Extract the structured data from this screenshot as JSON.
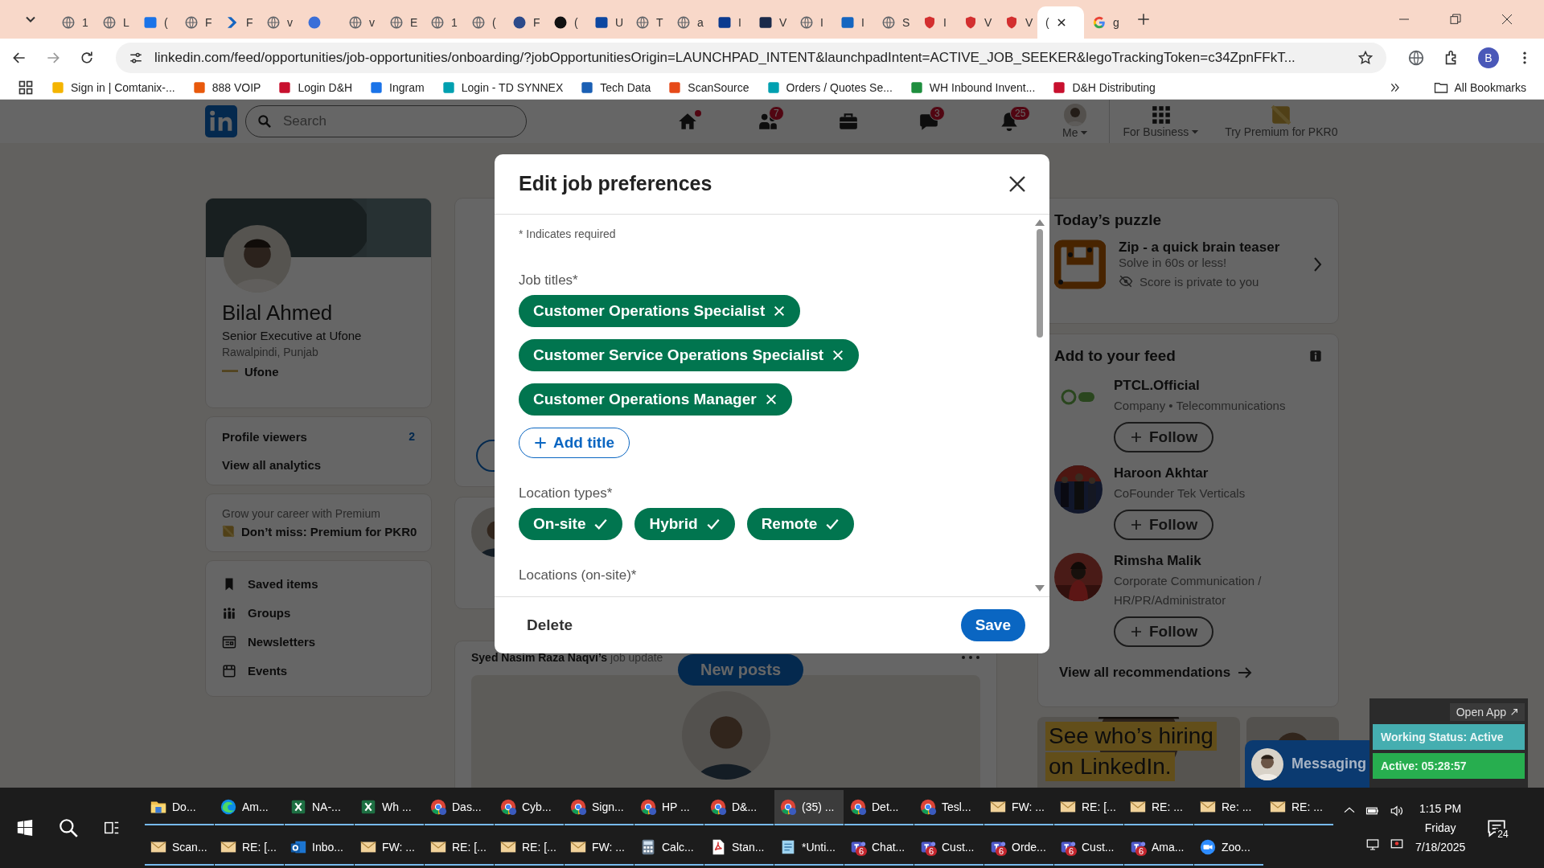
{
  "browser": {
    "tabs": [
      {
        "title": "1",
        "kind": "globe",
        "selected": false
      },
      {
        "title": "L",
        "kind": "globe",
        "selected": false
      },
      {
        "title": "(",
        "kind": "square",
        "color": "#1a73e8",
        "selected": false
      },
      {
        "title": "F",
        "kind": "globe",
        "selected": false
      },
      {
        "title": "F",
        "kind": "chevron",
        "color": "#1565c0",
        "selected": false
      },
      {
        "title": "v",
        "kind": "globe",
        "selected": false
      },
      {
        "kind": "circle",
        "color": "#3b6fd8",
        "selected": false
      },
      {
        "title": "v",
        "kind": "globe",
        "selected": false
      },
      {
        "title": "E",
        "kind": "globe",
        "selected": false
      },
      {
        "title": "1",
        "kind": "globe",
        "selected": false
      },
      {
        "title": "(",
        "kind": "globe",
        "selected": false
      },
      {
        "title": "F",
        "kind": "circle",
        "color": "#2c4a8a",
        "selected": false
      },
      {
        "title": "(",
        "kind": "circle",
        "color": "#111111",
        "selected": false
      },
      {
        "title": "U",
        "kind": "square",
        "color": "#0d47a1",
        "selected": false
      },
      {
        "title": "T",
        "kind": "globe",
        "selected": false
      },
      {
        "title": "a",
        "kind": "globe",
        "selected": false
      },
      {
        "title": "I",
        "kind": "square",
        "color": "#0b3a8f",
        "selected": false
      },
      {
        "title": "V",
        "kind": "square",
        "color": "#1b2a4a",
        "selected": false
      },
      {
        "title": "I",
        "kind": "globe",
        "selected": false
      },
      {
        "title": "I",
        "kind": "square",
        "color": "#1565c0",
        "selected": false
      },
      {
        "title": "S",
        "kind": "globe",
        "selected": false
      },
      {
        "title": "I",
        "kind": "shield",
        "color": "#d32f2f",
        "selected": false
      },
      {
        "title": "V",
        "kind": "shield",
        "color": "#d32f2f",
        "selected": false
      },
      {
        "title": "V",
        "kind": "shield",
        "color": "#d32f2f",
        "selected": false
      },
      {
        "title": "(",
        "selected": true
      },
      {
        "title": "g",
        "kind": "google",
        "selected": false
      }
    ],
    "url": "linkedin.com/feed/opportunities/job-opportunities/onboarding/?jobOpportunitiesOrigin=LAUNCHPAD_INTENT&launchpadIntent=ACTIVE_JOB_SEEKER&legoTrackingToken=c34ZpnFFkT...",
    "profile": "B",
    "bookmarks": [
      {
        "label": "Sign in | Comtanix-...",
        "color": "#f4b400"
      },
      {
        "label": "888 VOIP",
        "color": "#e8590c"
      },
      {
        "label": "Login D&H",
        "color": "#c8102e"
      },
      {
        "label": "Ingram",
        "color": "#1a73e8"
      },
      {
        "label": "Login - TD SYNNEX",
        "color": "#00a0b0"
      },
      {
        "label": "Tech Data",
        "color": "#1a5fb4"
      },
      {
        "label": "ScanSource",
        "color": "#e64a19"
      },
      {
        "label": "Orders / Quotes Se...",
        "color": "#00a0b0"
      },
      {
        "label": "WH Inbound Invent...",
        "color": "#1e8e3e"
      },
      {
        "label": "D&H Distributing",
        "color": "#c8102e"
      }
    ],
    "all_bookmarks": "All Bookmarks"
  },
  "header": {
    "search": {
      "placeholder": "Search"
    },
    "nav": [
      {
        "kind": "home",
        "dot": true
      },
      {
        "kind": "people",
        "badge": "7"
      },
      {
        "kind": "briefcase"
      },
      {
        "kind": "messaging",
        "badge": "3"
      },
      {
        "kind": "bell",
        "badge": "25"
      },
      {
        "kind": "avatar",
        "label": "Me",
        "caret": true
      },
      {
        "kind": "grid",
        "label": "For Business",
        "caret": true
      },
      {
        "kind": "premium",
        "label": "Try Premium for PKR0"
      }
    ]
  },
  "profile": {
    "name": "Bilal Ahmed",
    "headline": "Senior Executive at Ufone",
    "location": "Rawalpindi, Punjab",
    "company": "Ufone"
  },
  "analytics": {
    "label": "Profile viewers",
    "value": "2",
    "link": "View all analytics"
  },
  "premium": {
    "teaser": "Grow your career with Premium",
    "link": "Don’t miss: Premium for PKR0"
  },
  "shortcuts": [
    {
      "kind": "bookmark",
      "label": "Saved items"
    },
    {
      "kind": "groups",
      "label": "Groups"
    },
    {
      "kind": "newsletter",
      "label": "Newsletters"
    },
    {
      "kind": "calendar",
      "label": "Events"
    }
  ],
  "feed": {
    "new_posts": "New posts",
    "post_header": "**Syed Nasim Raza Naqvi’s** job update"
  },
  "puzzle": {
    "title": "Today’s puzzle",
    "name": "Zip - a quick brain teaser",
    "subtitle": "Solve in 60s or less!",
    "note": "Score is private to you"
  },
  "suggestions": {
    "title": "Add to your feed",
    "items": [
      {
        "name": "PTCL.Official",
        "subtitle": "Company • Telecommunications",
        "kind": "logo",
        "action": "Follow"
      },
      {
        "name": "Haroon Akhtar",
        "subtitle": "CoFounder Tek Verticals",
        "kind": "picture",
        "action": "Follow"
      },
      {
        "name": "Rimsha Malik",
        "subtitle": "Corporate Communication / HR/PR/Administrator",
        "kind": "picture",
        "action": "Follow"
      }
    ],
    "view_all": "View all recommendations"
  },
  "ad": {
    "lines": [
      "See who’s hiring",
      "on LinkedIn."
    ]
  },
  "messaging": {
    "label": "Messaging"
  },
  "status_widget": {
    "open_app": "Open App",
    "status": "Working Status: Active",
    "timer": "Active: 05:28:57"
  },
  "dialog": {
    "title": "Edit job preferences",
    "required_note": "* Indicates required",
    "sections": [
      {
        "kind": "titles",
        "label": "Job titles*",
        "chips": [
          {
            "label": "Customer Operations Specialist"
          },
          {
            "label": "Customer Service Operations Specialist"
          },
          {
            "label": "Customer Operations Manager"
          }
        ],
        "add": "Add title"
      },
      {
        "kind": "types",
        "label": "Location types*",
        "chips": [
          {
            "label": "On-site",
            "checked": true
          },
          {
            "label": "Hybrid",
            "checked": true
          },
          {
            "label": "Remote",
            "checked": true
          }
        ]
      },
      {
        "kind": "heading",
        "label": "Locations (on-site)*"
      }
    ],
    "delete": "Delete",
    "save": "Save"
  },
  "taskbar": {
    "rows": [
      [
        {
          "kind": "folder",
          "label": "Do...",
          "selected": false
        },
        {
          "kind": "edge",
          "label": "Am...",
          "selected": false
        },
        {
          "kind": "excel",
          "label": "NA-...",
          "selected": false
        },
        {
          "kind": "excel",
          "label": "Wh ...",
          "selected": false
        },
        {
          "kind": "chrome",
          "label": "Das...",
          "selected": false
        },
        {
          "kind": "chrome",
          "label": "Cyb...",
          "selected": false
        },
        {
          "kind": "chrome",
          "label": "Sign...",
          "selected": false
        },
        {
          "kind": "chrome",
          "label": "HP ...",
          "selected": false
        },
        {
          "kind": "chrome",
          "label": "D&...",
          "selected": false
        },
        {
          "kind": "chrome",
          "label": "(35) ...",
          "selected": true
        },
        {
          "kind": "chrome",
          "label": "Det...",
          "selected": false
        },
        {
          "kind": "chrome",
          "label": "Tesl...",
          "selected": false
        },
        {
          "kind": "mail",
          "label": "FW: ...",
          "selected": false
        },
        {
          "kind": "mail",
          "label": "RE: [...",
          "selected": false
        },
        {
          "kind": "mail",
          "label": "RE: ...",
          "selected": false
        },
        {
          "kind": "mail",
          "label": "Re: ...",
          "selected": false
        },
        {
          "kind": "mail",
          "label": "RE: ...",
          "selected": false
        }
      ],
      [
        {
          "kind": "mail",
          "label": "Scan...",
          "selected": false
        },
        {
          "kind": "mail",
          "label": "RE: [...",
          "selected": false
        },
        {
          "kind": "outlook",
          "label": "Inbo...",
          "selected": false
        },
        {
          "kind": "mail",
          "label": "FW: ...",
          "selected": false
        },
        {
          "kind": "mail",
          "label": "RE: [...",
          "selected": false
        },
        {
          "kind": "mail",
          "label": "RE: [...",
          "selected": false
        },
        {
          "kind": "mail",
          "label": "FW: ...",
          "selected": false
        },
        {
          "kind": "calculator",
          "label": "Calc...",
          "selected": false
        },
        {
          "kind": "pdf",
          "label": "Stan...",
          "selected": false
        },
        {
          "kind": "notepad",
          "label": "*Unti...",
          "selected": false
        },
        {
          "kind": "teams",
          "badge": "6",
          "label": "Chat...",
          "selected": false
        },
        {
          "kind": "teams",
          "badge": "6",
          "label": "Cust...",
          "selected": false
        },
        {
          "kind": "teams",
          "badge": "6",
          "label": "Orde...",
          "selected": false
        },
        {
          "kind": "teams",
          "badge": "6",
          "label": "Cust...",
          "selected": false
        },
        {
          "kind": "teams",
          "badge": "6",
          "label": "Ama...",
          "selected": false
        },
        {
          "kind": "zoom",
          "label": "Zoo...",
          "selected": false
        }
      ]
    ],
    "clock": {
      "time": "1:15 PM",
      "day": "Friday",
      "date": "7/18/2025"
    },
    "notifications": "24"
  }
}
